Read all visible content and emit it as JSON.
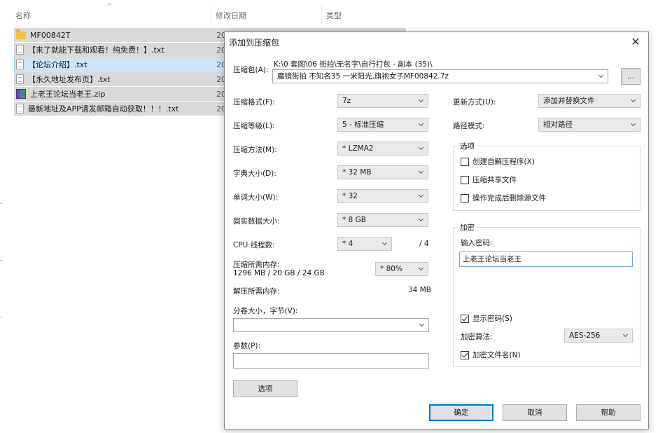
{
  "explorer": {
    "columns": {
      "name": "名称",
      "date": "修改日期",
      "type": "类型"
    },
    "files": [
      {
        "name": "MF00842T",
        "date": "20",
        "icon": "folder-icon"
      },
      {
        "name": "【来了就能下载和观看！纯免费！】.txt",
        "date": "20",
        "icon": "text-file-icon"
      },
      {
        "name": "【论坛介绍】.txt",
        "date": "20",
        "icon": "text-file-icon"
      },
      {
        "name": "【永久地址发布页】.txt",
        "date": "20",
        "icon": "text-file-icon"
      },
      {
        "name": "上老王论坛当老王.zip",
        "date": "20",
        "icon": "archive-icon"
      },
      {
        "name": "最新地址及APP请发邮箱自动获取！！！.txt",
        "date": "20",
        "icon": "text-file-icon"
      }
    ]
  },
  "dialog": {
    "title": "添加到压缩包",
    "archive_label": "压缩包(A):",
    "archive_path_line1": "K:\\0 套图\\06 街拍\\无名字\\自行打包 - 副本 (35)\\",
    "archive_path_line2": "魔镜街拍 不知名35 一米阳光,旗袍女子MF00842.7z",
    "browse_label": "...",
    "format_label": "压缩格式(F):",
    "format_value": "7z",
    "level_label": "压缩等级(L):",
    "level_value": "5 - 标准压缩",
    "method_label": "压缩方法(M):",
    "method_value": "* LZMA2",
    "dict_label": "字典大小(D):",
    "dict_value": "* 32 MB",
    "word_label": "单词大小(W):",
    "word_value": "* 32",
    "solid_label": "固实数据大小:",
    "solid_value": "* 8 GB",
    "threads_label": "CPU 线程数:",
    "threads_value": "* 4",
    "threads_total": "/ 4",
    "mem_comp_label": "压缩所需内存:",
    "mem_comp_detail": "1296 MB / 20 GB / 24 GB",
    "mem_comp_value": "* 80%",
    "mem_decomp_label": "解压所需内存:",
    "mem_decomp_value": "34 MB",
    "split_label": "分卷大小，字节(V):",
    "split_value": "",
    "params_label": "参数(P):",
    "params_value": "",
    "options_button": "选项",
    "update_label": "更新方式(U):",
    "update_value": "添加并替换文件",
    "path_label": "路径模式:",
    "path_value": "相对路径",
    "options_group": "选项",
    "opt_sfx": "创建自解压程序(X)",
    "opt_shared": "压缩共享文件",
    "opt_delete": "操作完成后删除源文件",
    "encrypt_group": "加密",
    "password_label": "输入密码:",
    "password_value": "上老王论坛当老王",
    "show_password": "显示密码(S)",
    "enc_method_label": "加密算法:",
    "enc_method_value": "AES-256",
    "encrypt_names": "加密文件名(N)",
    "ok": "确定",
    "cancel": "取消",
    "help": "帮助"
  }
}
